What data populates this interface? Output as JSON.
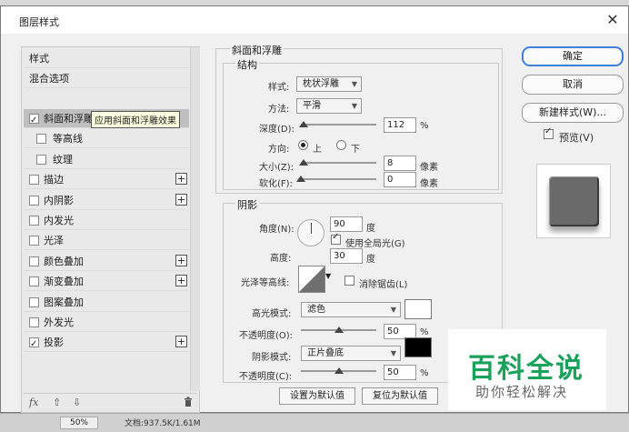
{
  "window": {
    "title": "图层样式"
  },
  "status": {
    "zoom": "50%",
    "doc": "文档:937.5K/1.61M"
  },
  "left_panel": {
    "header": "样式",
    "blend": "混合选项",
    "items": [
      {
        "label": "斜面和浮雕",
        "checked": true,
        "plus": false
      },
      {
        "label": "等高线",
        "checked": false,
        "plus": false
      },
      {
        "label": "纹理",
        "checked": false,
        "plus": false
      },
      {
        "label": "描边",
        "checked": false,
        "plus": true
      },
      {
        "label": "内阴影",
        "checked": false,
        "plus": true
      },
      {
        "label": "内发光",
        "checked": false,
        "plus": false
      },
      {
        "label": "光泽",
        "checked": false,
        "plus": false
      },
      {
        "label": "颜色叠加",
        "checked": false,
        "plus": true
      },
      {
        "label": "渐变叠加",
        "checked": false,
        "plus": true
      },
      {
        "label": "图案叠加",
        "checked": false,
        "plus": false
      },
      {
        "label": "外发光",
        "checked": false,
        "plus": false
      },
      {
        "label": "投影",
        "checked": true,
        "plus": true
      }
    ],
    "tooltip": "应用斜面和浮雕效果",
    "footer": {
      "fx": "fx",
      "up": "⇧",
      "down": "⇩",
      "trash": "🗑"
    }
  },
  "bevel": {
    "section": "斜面和浮雕",
    "structure": "结构",
    "style_label": "样式:",
    "style_value": "枕状浮雕",
    "method_label": "方法:",
    "method_value": "平滑",
    "depth_label": "深度(D):",
    "depth_value": "112",
    "depth_unit": "%",
    "depth_level": 0.04,
    "direction_label": "方向:",
    "dir_up": "上",
    "dir_down": "下",
    "size_label": "大小(Z):",
    "size_value": "8",
    "size_unit": "像素",
    "size_level": 0.04,
    "soften_label": "软化(F):",
    "soften_value": "0",
    "soften_unit": "像素",
    "soften_level": 0.0
  },
  "shading": {
    "section": "阴影",
    "angle_label": "角度(N):",
    "angle_value": "90",
    "angle_unit": "度",
    "global_light": "使用全局光(G)",
    "altitude_label": "高度:",
    "altitude_value": "30",
    "altitude_unit": "度",
    "gloss_label": "光泽等高线:",
    "antialias": "消除锯齿(L)",
    "highlight_mode_label": "高光模式:",
    "highlight_mode_value": "滤色",
    "highlight_color": "#ffffff",
    "opacity1_label": "不透明度(O):",
    "opacity1_value": "50",
    "opacity1_unit": "%",
    "opacity1_level": 0.5,
    "shadow_mode_label": "阴影模式:",
    "shadow_mode_value": "正片叠底",
    "shadow_color": "#000000",
    "opacity2_label": "不透明度(C):",
    "opacity2_value": "50",
    "opacity2_unit": "%",
    "opacity2_level": 0.5
  },
  "buttons": {
    "make_default": "设置为默认值",
    "reset_default": "复位为默认值",
    "ok": "确定",
    "cancel": "取消",
    "new_style": "新建样式(W)...",
    "preview": "预览(V)"
  },
  "watermark": {
    "line1": "百科全说",
    "line2": "助你轻松解决"
  }
}
